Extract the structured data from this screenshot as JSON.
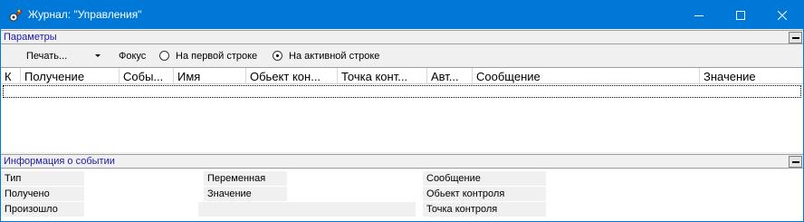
{
  "window": {
    "title": "Журнал: \"Управления\""
  },
  "params_section": {
    "title": "Параметры"
  },
  "toolbar": {
    "print_label": "Печать...",
    "focus_label": "Фокус",
    "radio_first_row": "На первой строке",
    "radio_active_row": "На активной строке",
    "selected_focus": "На активной строке"
  },
  "grid": {
    "columns": [
      "К",
      "Получение",
      "Собы...",
      "Имя",
      "Обьект кон...",
      "Точка конт...",
      "Авт...",
      "Сообщение",
      "Значение"
    ]
  },
  "info_section": {
    "title": "Информация о событии",
    "labels": {
      "type": "Тип",
      "received": "Получено",
      "occurred": "Произошло",
      "variable": "Переменная",
      "value": "Значение",
      "message": "Сообщение",
      "control_object": "Обьект контроля",
      "control_point": "Точка контроля"
    }
  }
}
